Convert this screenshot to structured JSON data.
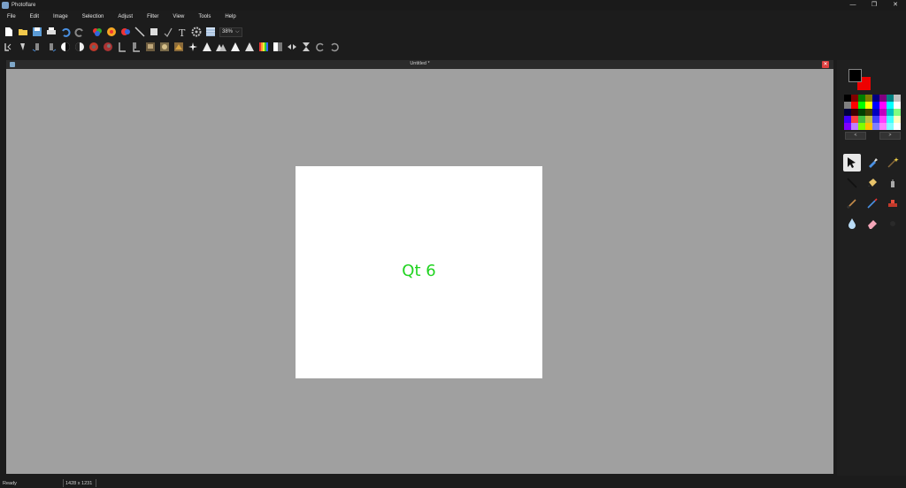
{
  "app": {
    "title": "Photoflare"
  },
  "window_controls": {
    "minimize": "—",
    "restore": "❐",
    "close": "✕"
  },
  "menu": [
    "File",
    "Edit",
    "Image",
    "Selection",
    "Adjust",
    "Filter",
    "View",
    "Tools",
    "Help"
  ],
  "toolbar": {
    "zoom_value": "38%",
    "row1_icons": [
      "new-file-icon",
      "open-folder-icon",
      "save-icon",
      "print-icon",
      "undo-icon",
      "redo-icon",
      "color-balance-icon",
      "hue-saturation-icon",
      "color-swap-icon",
      "line-icon",
      "crop-icon",
      "select-icon",
      "text-icon",
      "settings-icon",
      "grid-icon"
    ],
    "row2_icons": [
      "flip-horizontal-icon",
      "flip-vertical-icon",
      "rotate-left-icon",
      "rotate-right-icon",
      "auto-contrast-icon",
      "levels-icon",
      "red-tint-icon",
      "red-balance-icon",
      "crop-left-icon",
      "crop-right-icon",
      "sepia-icon",
      "emboss-icon",
      "oil-paint-icon",
      "sparkle-icon",
      "triangle-icon",
      "triangle-small-icon",
      "triangle-outline-icon",
      "triangle-fill-icon",
      "rainbow-gradient-icon",
      "gray-gradient-icon",
      "flip-arrows-icon",
      "hourglass-icon",
      "rotate-ccw-icon",
      "rotate-cw-icon"
    ]
  },
  "document": {
    "title": "Untitled *",
    "close": "✕"
  },
  "canvas": {
    "text": "Qt 6",
    "text_color": "#1fd31f"
  },
  "colors": {
    "foreground": "#000000",
    "background": "#ee0000",
    "palette": [
      "#000000",
      "#800000",
      "#008000",
      "#808000",
      "#000080",
      "#800080",
      "#008080",
      "#c0c0c0",
      "#808080",
      "#ff0000",
      "#00ff00",
      "#ffff00",
      "#0000ff",
      "#ff00ff",
      "#00ffff",
      "#ffffff",
      "#000040",
      "#400000",
      "#004000",
      "#404000",
      "#0000c0",
      "#c000c0",
      "#00c0c0",
      "#80ff80",
      "#4000ff",
      "#ff4040",
      "#40c040",
      "#c0c040",
      "#4040ff",
      "#ff40ff",
      "#40ffff",
      "#ffffc0",
      "#8000ff",
      "#c080ff",
      "#80ff00",
      "#ffc000",
      "#8080ff",
      "#ff80ff",
      "#80ffff",
      "#ffffff"
    ],
    "prev_label": "<",
    "next_label": ">"
  },
  "tools": [
    "pointer-tool",
    "eyedropper-tool",
    "magic-wand-tool",
    "line-tool",
    "paint-bucket-tool",
    "spray-can-tool",
    "brush-tool",
    "pen-tool",
    "stamp-tool",
    "blur-tool",
    "eraser-tool",
    "empty-tool"
  ],
  "status": {
    "ready": "Ready",
    "image_size": "1428 x 1231"
  }
}
